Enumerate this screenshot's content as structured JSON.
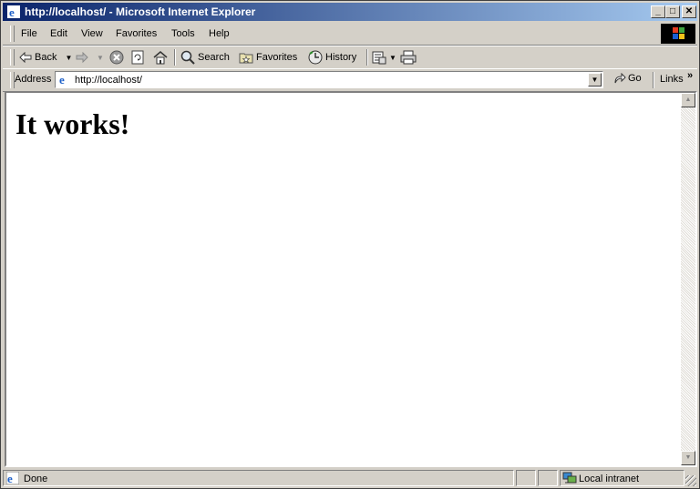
{
  "window": {
    "title": "http://localhost/ - Microsoft Internet Explorer",
    "caption_buttons": {
      "minimize": "_",
      "maximize": "□",
      "close": "✕"
    }
  },
  "menu": {
    "items": [
      "File",
      "Edit",
      "View",
      "Favorites",
      "Tools",
      "Help"
    ]
  },
  "toolbar": {
    "back_label": "Back",
    "search_label": "Search",
    "favorites_label": "Favorites",
    "history_label": "History"
  },
  "address_bar": {
    "label": "Address",
    "url": "http://localhost/",
    "go_label": "Go",
    "links_label": "Links",
    "links_chevron": "»"
  },
  "page": {
    "heading": "It works!"
  },
  "status_bar": {
    "status": "Done",
    "zone": "Local intranet"
  },
  "colors": {
    "titlebar_start": "#0a246a",
    "titlebar_end": "#a6caf0",
    "chrome": "#d4d0c8"
  }
}
